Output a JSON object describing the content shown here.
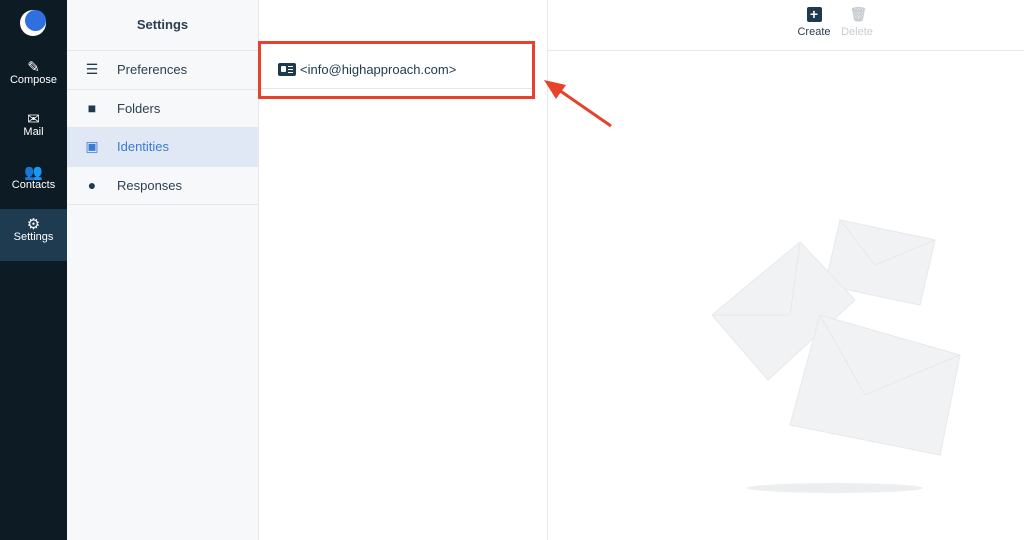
{
  "rail": {
    "items": [
      {
        "label": "Compose",
        "icon": "compose-icon"
      },
      {
        "label": "Mail",
        "icon": "mail-icon"
      },
      {
        "label": "Contacts",
        "icon": "contacts-icon"
      },
      {
        "label": "Settings",
        "icon": "gear-icon",
        "active": true
      }
    ]
  },
  "settings": {
    "title": "Settings",
    "items": [
      {
        "label": "Preferences",
        "icon": "sliders-icon"
      },
      {
        "label": "Folders",
        "icon": "folder-icon"
      },
      {
        "label": "Identities",
        "icon": "id-card-icon",
        "active": true
      },
      {
        "label": "Responses",
        "icon": "speech-bubble-icon"
      }
    ]
  },
  "identities": [
    {
      "label": "<info@highapproach.com>"
    }
  ],
  "toolbar": {
    "create": "Create",
    "delete": "Delete"
  },
  "colors": {
    "rail": "#0d1b24",
    "accent": "#3a7bd5",
    "annotation": "#e8412c"
  }
}
